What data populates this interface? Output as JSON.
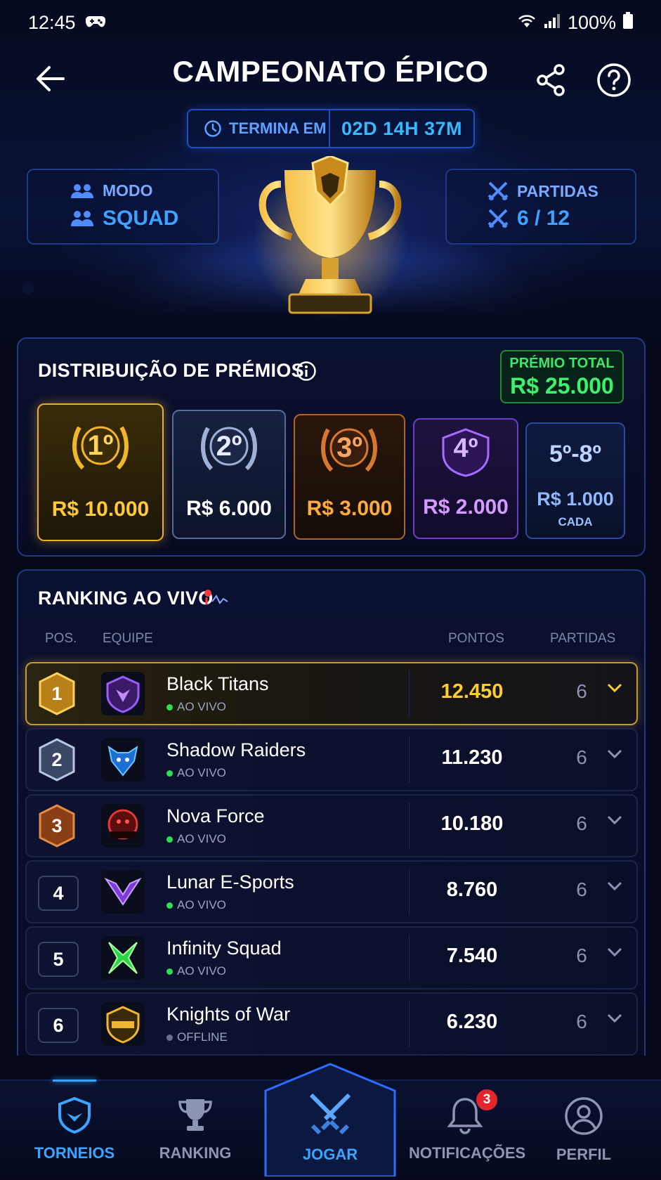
{
  "status_bar": {
    "time": "12:45",
    "battery": "100%"
  },
  "header": {
    "title": "CAMPEONATO ÉPICO"
  },
  "timer": {
    "label": "TERMINA EM",
    "value": "02D 14H 37M"
  },
  "mode": {
    "label": "MODO",
    "value": "SQUAD"
  },
  "matches": {
    "label": "PARTIDAS",
    "value": "6 / 12"
  },
  "prizes": {
    "title": "DISTRIBUIÇÃO DE PRÉMIOS",
    "total_label": "PRÉMIO TOTAL",
    "total_value": "R$ 25.000",
    "items": [
      {
        "place": "1º",
        "amount": "R$ 10.000"
      },
      {
        "place": "2º",
        "amount": "R$ 6.000"
      },
      {
        "place": "3º",
        "amount": "R$ 3.000"
      },
      {
        "place": "4º",
        "amount": "R$ 2.000"
      },
      {
        "place": "5º-8º",
        "amount": "R$ 1.000",
        "note": "CADA"
      }
    ]
  },
  "ranking": {
    "title": "RANKING AO VIVO",
    "columns": {
      "pos": "POS.",
      "team": "EQUIPE",
      "points": "PONTOS",
      "matches": "PARTIDAS"
    },
    "rows": [
      {
        "pos": "1",
        "team": "Black Titans",
        "status": "AO VIVO",
        "points": "12.450",
        "matches": "6"
      },
      {
        "pos": "2",
        "team": "Shadow Raiders",
        "status": "AO VIVO",
        "points": "11.230",
        "matches": "6"
      },
      {
        "pos": "3",
        "team": "Nova Force",
        "status": "AO VIVO",
        "points": "10.180",
        "matches": "6"
      },
      {
        "pos": "4",
        "team": "Lunar E-Sports",
        "status": "AO VIVO",
        "points": "8.760",
        "matches": "6"
      },
      {
        "pos": "5",
        "team": "Infinity Squad",
        "status": "AO VIVO",
        "points": "7.540",
        "matches": "6"
      },
      {
        "pos": "6",
        "team": "Knights of War",
        "status": "OFFLINE",
        "points": "6.230",
        "matches": "6"
      }
    ]
  },
  "nav": {
    "items": [
      {
        "label": "TORNEIOS"
      },
      {
        "label": "RANKING"
      },
      {
        "label": "JOGAR"
      },
      {
        "label": "NOTIFICAÇÕES",
        "badge": "3"
      },
      {
        "label": "PERFIL"
      }
    ]
  }
}
